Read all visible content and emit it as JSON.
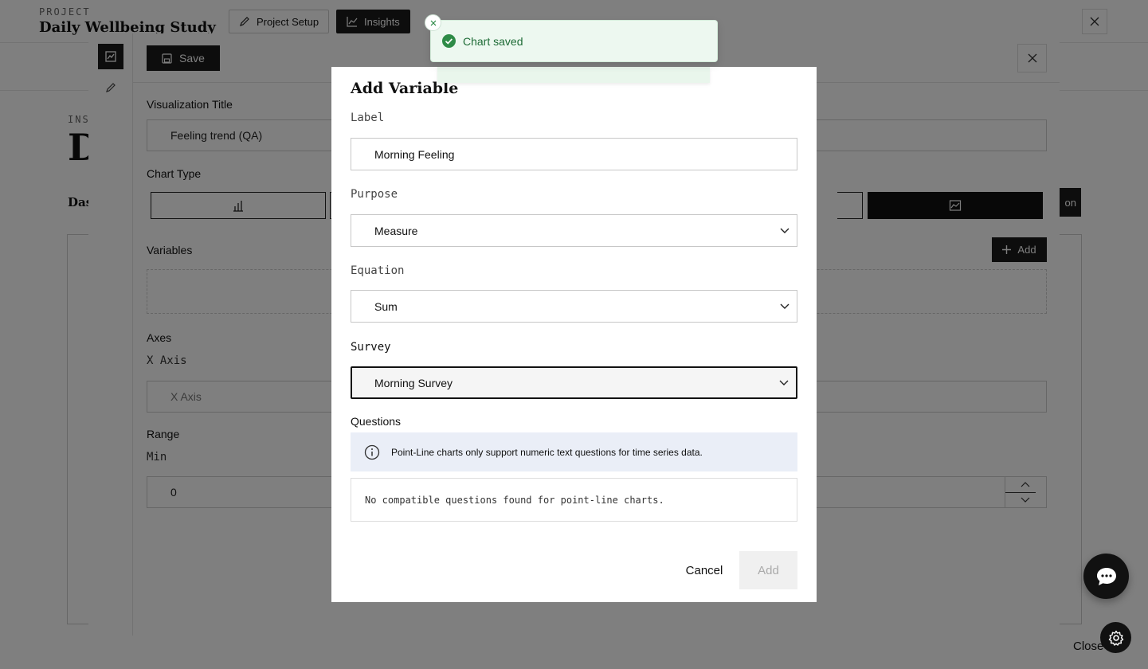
{
  "page": {
    "project_label": "PROJECT",
    "project_name": "Daily Wellbeing Study",
    "tabs": [
      {
        "label": "Project Setup",
        "icon": "pencil-icon"
      },
      {
        "label": "Insights",
        "icon": "line-chart-icon"
      }
    ],
    "insights_label": "INSI",
    "heading_partial": "D",
    "section_partial": "Das",
    "button_partial": "on",
    "close_label": "Close"
  },
  "editor": {
    "save_label": "Save",
    "visualization_title_label": "Visualization Title",
    "visualization_title_value": "Feeling trend (QA)",
    "chart_type_label": "Chart Type",
    "variables_label": "Variables",
    "add_label": "Add",
    "axes_label": "Axes",
    "x_axis_label": "X Axis",
    "x_axis_placeholder": "X Axis",
    "range_label": "Range",
    "min_label": "Min",
    "min_value": "0"
  },
  "dialog": {
    "title": "Add Variable",
    "label_field": {
      "label": "Label",
      "value": "Morning Feeling"
    },
    "purpose_field": {
      "label": "Purpose",
      "value": "Measure"
    },
    "equation_field": {
      "label": "Equation",
      "value": "Sum"
    },
    "survey_field": {
      "label": "Survey",
      "value": "Morning Survey"
    },
    "questions_label": "Questions",
    "info_text": "Point-Line charts only support numeric text questions for time series data.",
    "empty_text": "No compatible questions found for point-line charts.",
    "cancel_label": "Cancel",
    "add_label": "Add"
  },
  "toast": {
    "message": "Chart saved",
    "accent": "#2e8b47"
  },
  "colors": {
    "overlay": "rgba(0,0,0,0.5)",
    "primary": "#1a1a1a",
    "info_bg": "#eaeef7",
    "success": "#2e8b47"
  }
}
